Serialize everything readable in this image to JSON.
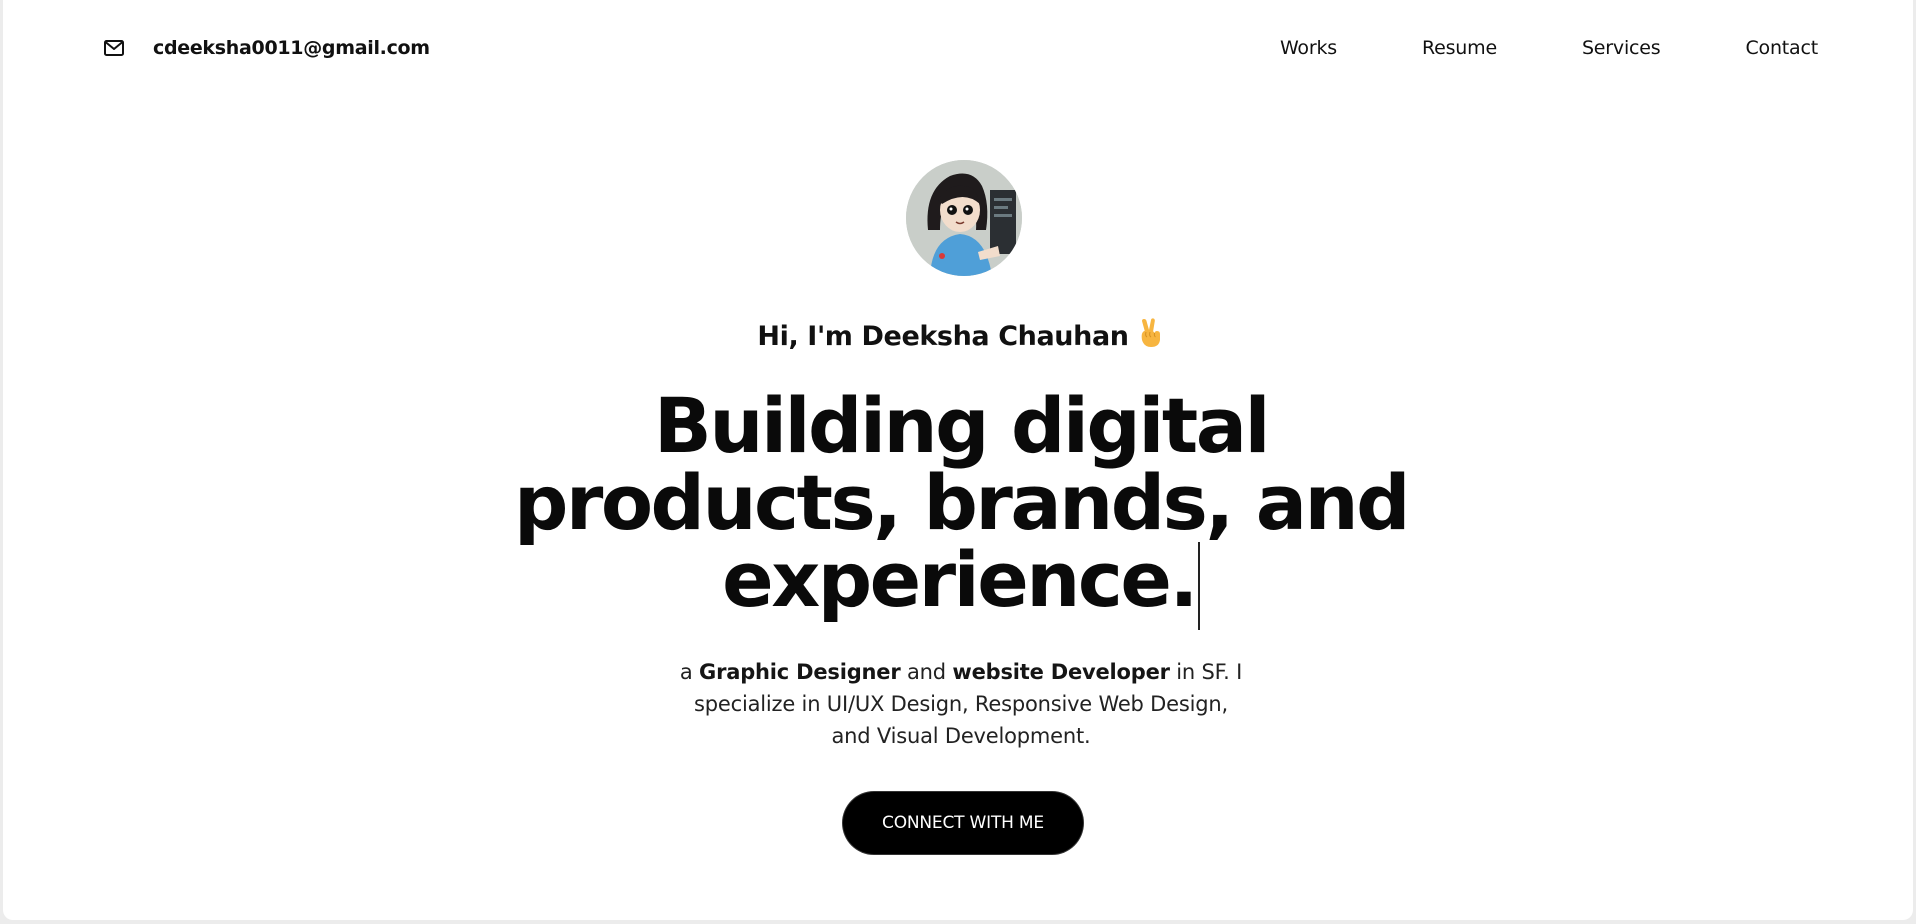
{
  "header": {
    "email": "cdeeksha0011@gmail.com",
    "nav": [
      "Works",
      "Resume",
      "Services",
      "Contact"
    ]
  },
  "hero": {
    "greeting": "Hi, I'm Deeksha Chauhan",
    "greeting_emoji": "victory-hand-icon",
    "headline_lines": [
      "Building digital",
      "products, brands, and",
      "experience."
    ],
    "bio": {
      "prefix": "a ",
      "role1": "Graphic Designer",
      "mid1": " and ",
      "role2": "website Developer",
      "line1_end": " in SF. I",
      "line2": "specialize in UI/UX Design, Responsive Web Design,",
      "line3": "and Visual Development."
    },
    "cta_label": "CONNECT WITH ME"
  },
  "colors": {
    "background": "#ffffff",
    "text": "#0a0a0a",
    "button_bg": "#000000",
    "button_text": "#ffffff",
    "avatar_shirt": "#4f9fd8"
  }
}
